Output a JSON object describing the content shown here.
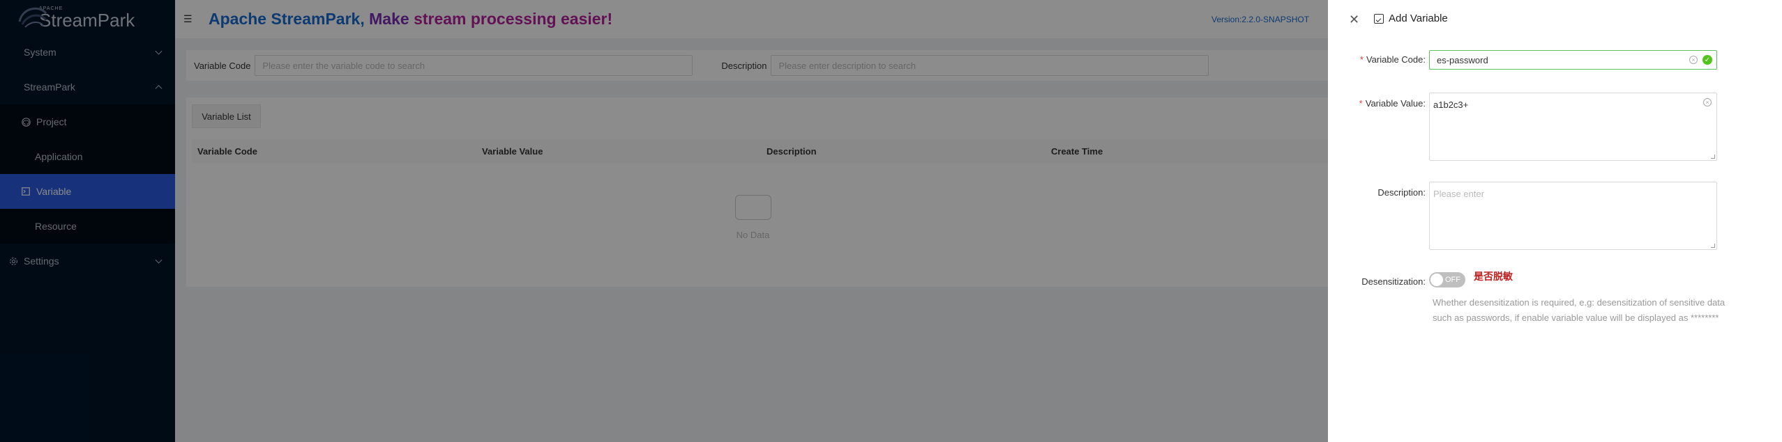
{
  "sidebar": {
    "logo_small": "APACHE",
    "logo_text": "StreamPark",
    "items": [
      {
        "label": "System"
      },
      {
        "label": "StreamPark"
      },
      {
        "label": "Project"
      },
      {
        "label": "Application"
      },
      {
        "label": "Variable"
      },
      {
        "label": "Resource"
      },
      {
        "label": "Settings"
      }
    ]
  },
  "header": {
    "slogan_a": "Apache StreamPark,",
    "slogan_b": "Make",
    "slogan_c": "stream processing easier!",
    "version": "Version:2.2.0-SNAPSHOT"
  },
  "search": {
    "code_label": "Variable Code",
    "code_placeholder": "Please enter the variable code to search",
    "desc_label": "Description",
    "desc_placeholder": "Please enter description to search"
  },
  "table": {
    "title": "Variable List",
    "columns": [
      "Variable Code",
      "Variable Value",
      "Description",
      "Create Time"
    ],
    "empty_text": "No Data"
  },
  "drawer": {
    "title": "Add Variable",
    "code_label": "Variable Code",
    "code_value": "es-password",
    "value_label": "Variable Value",
    "value_value": "a1b2c3+",
    "desc_label": "Description",
    "desc_placeholder": "Please enter",
    "desens_label": "Desensitization",
    "switch_text": "OFF",
    "switch_note": "是否脱敏",
    "help_text": "Whether desensitization is required, e.g: desensitization of sensitive data such as passwords, if enable variable value will be displayed as ********"
  },
  "colors": {
    "sidebar_bg": "#001529",
    "active_item": "#2a5bdf",
    "success": "#52c41a",
    "required": "#e23b3b"
  }
}
